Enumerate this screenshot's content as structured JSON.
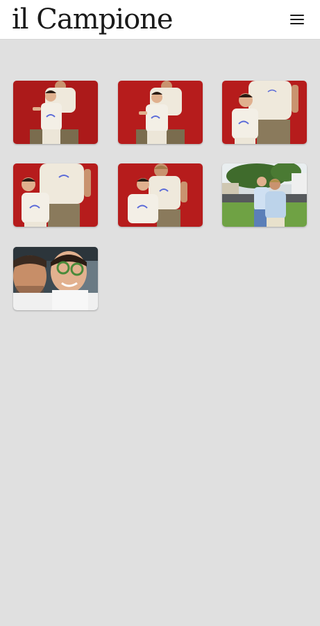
{
  "header": {
    "logo_text": "il Campione",
    "menu_icon": "hamburger-menu-icon"
  },
  "gallery": {
    "photos": [
      {
        "name": "photo-1",
        "depicts": "man-and-boy-red-wall"
      },
      {
        "name": "photo-2",
        "depicts": "man-and-boy-red-wall"
      },
      {
        "name": "photo-3",
        "depicts": "man-and-boy-red-wall"
      },
      {
        "name": "photo-4",
        "depicts": "man-and-boy-red-wall"
      },
      {
        "name": "photo-5",
        "depicts": "man-and-boy-red-wall"
      },
      {
        "name": "photo-6",
        "depicts": "man-and-boy-outdoors"
      },
      {
        "name": "photo-7",
        "depicts": "selfie-man-and-boy"
      }
    ]
  },
  "colors": {
    "background": "#e0e0e0",
    "header_bg": "#ffffff",
    "red_wall": "#b61c1c",
    "shirt": "#efe9dc",
    "trousers": "#8a7a5c"
  }
}
